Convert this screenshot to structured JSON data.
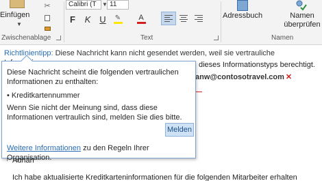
{
  "ribbon": {
    "paste_label": "Einfügen",
    "clipboard_group_label": "Zwischenablage",
    "font_name": "Calibri (T",
    "font_size": "11",
    "text_group_label": "Text",
    "addressbook_label": "Adressbuch",
    "check_names_label_1": "Namen",
    "check_names_label_2": "überprüfen",
    "names_group_label": "Namen",
    "bold_label": "F",
    "italic_label": "K",
    "underline_label": "U",
    "highlight_color": "#ffe600",
    "font_color": "#d4201d",
    "font_color_label": "A"
  },
  "policy_tip": {
    "label": "Richtlinientipp:",
    "text": "Diese Nachricht kann nicht gesendet werden, weil sie vertrauliche Informationen zu",
    "text_cont": "dieses Informationstyps berechtigt."
  },
  "recipients": {
    "visible_bold": "anw@contosotravel.com"
  },
  "popup": {
    "line1": "Diese Nachricht scheint die folgenden vertraulichen",
    "line2": "Informationen zu enthalten:",
    "bullet": "• Kreditkartennummer",
    "line3": "Wenn Sie nicht der Meinung sind, dass diese",
    "line4": "Informationen vertraulich sind, melden Sie dies bitte.",
    "report_button": "Melden",
    "more_info_link": "Weitere Informationen",
    "more_info_rest": " zu den Regeln Ihrer Organisation."
  },
  "body": {
    "greeting": "Adrian",
    "text_line": "Ich habe aktualisierte Kreditkarteninformationen für die folgenden Mitarbeiter erhalten"
  }
}
